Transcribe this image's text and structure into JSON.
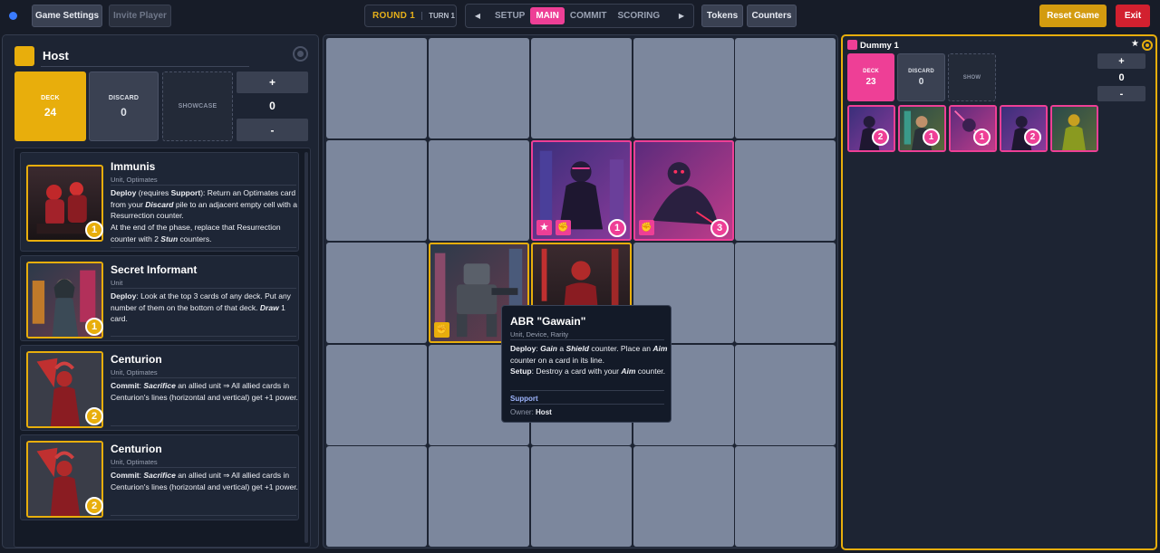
{
  "topbar": {
    "game_settings": "Game Settings",
    "invite_player": "Invite Player",
    "round": "ROUND 1",
    "turn": "TURN 1",
    "phases": [
      "SETUP",
      "MAIN",
      "COMMIT",
      "SCORING"
    ],
    "active_phase": "MAIN",
    "tokens": "Tokens",
    "counters": "Counters",
    "reset_game": "Reset Game",
    "exit": "Exit"
  },
  "colors": {
    "gold": "#e8ae0c",
    "pink": "#ee3f96",
    "background": "#171c28",
    "cell": "#7c879d"
  },
  "host": {
    "name": "Host",
    "deck_label": "DECK",
    "deck_count": "24",
    "discard_label": "DISCARD",
    "discard_count": "0",
    "showcase_label": "SHOWCASE",
    "counter_plus": "+",
    "counter_value": "0",
    "counter_minus": "-",
    "hand": [
      {
        "title": "Immunis",
        "type": "Unit, Optimates",
        "badge": "1",
        "text_html": "<b>Deploy</b> (requires <b>Support</b>): Return an Optimates card from your <b><i>Discard</i></b> pile to an adjacent empty cell with a Resurrection counter.<br>At the end of the phase, replace that Resurrection counter with 2 <b><i>Stun</i></b> counters."
      },
      {
        "title": "Secret Informant",
        "type": "Unit",
        "badge": "1",
        "text_html": "<b>Deploy</b>: Look at the top 3 cards of any deck. Put any number of them on the bottom of that deck. <b><i>Draw</i></b> 1 card."
      },
      {
        "title": "Centurion",
        "type": "Unit, Optimates",
        "badge": "2",
        "text_html": "<b>Commit</b>: <b><i>Sacrifice</i></b> an allied unit ⇒ All allied cards in Centurion's lines (horizontal and vertical) get +1 power."
      },
      {
        "title": "Centurion",
        "type": "Unit, Optimates",
        "badge": "2",
        "text_html": "<b>Commit</b>: <b><i>Sacrifice</i></b> an allied unit ⇒ All allied cards in Centurion's lines (horizontal and vertical) get +1 power."
      }
    ]
  },
  "board": {
    "cards": [
      {
        "owner": "dummy",
        "badge": "1",
        "icons": [
          "star-icon",
          "fist-icon"
        ]
      },
      {
        "owner": "dummy",
        "badge": "3",
        "icons": [
          "fist-icon"
        ]
      },
      {
        "owner": "host",
        "badge": "",
        "icons": [
          "fist-icon"
        ]
      },
      {
        "owner": "host",
        "badge": "",
        "icons": []
      }
    ],
    "glyphs": {
      "star": "★",
      "fist": "✊"
    }
  },
  "tooltip": {
    "title": "ABR \"Gawain\"",
    "type": "Unit, Device, Rarity",
    "text_html": "<b>Deploy</b>: <b><i>Gain</i></b> a <b><i>Shield</i></b> counter. Place an <b><i>Aim</i></b> counter on a card in its line.<br><b>Setup</b>: Destroy a card with your <b><i>Aim</i></b> counter.",
    "tag": "Support",
    "owner_label": "Owner:",
    "owner": "Host"
  },
  "dummy": {
    "name": "Dummy 1",
    "star": "★",
    "deck_label": "DECK",
    "deck_count": "23",
    "discard_label": "DISCARD",
    "discard_count": "0",
    "show_label": "SHOW",
    "counter_plus": "+",
    "counter_value": "0",
    "counter_minus": "-",
    "cards": [
      {
        "badge": "2"
      },
      {
        "badge": "1"
      },
      {
        "badge": "1"
      },
      {
        "badge": "2"
      },
      {
        "badge": ""
      }
    ]
  }
}
